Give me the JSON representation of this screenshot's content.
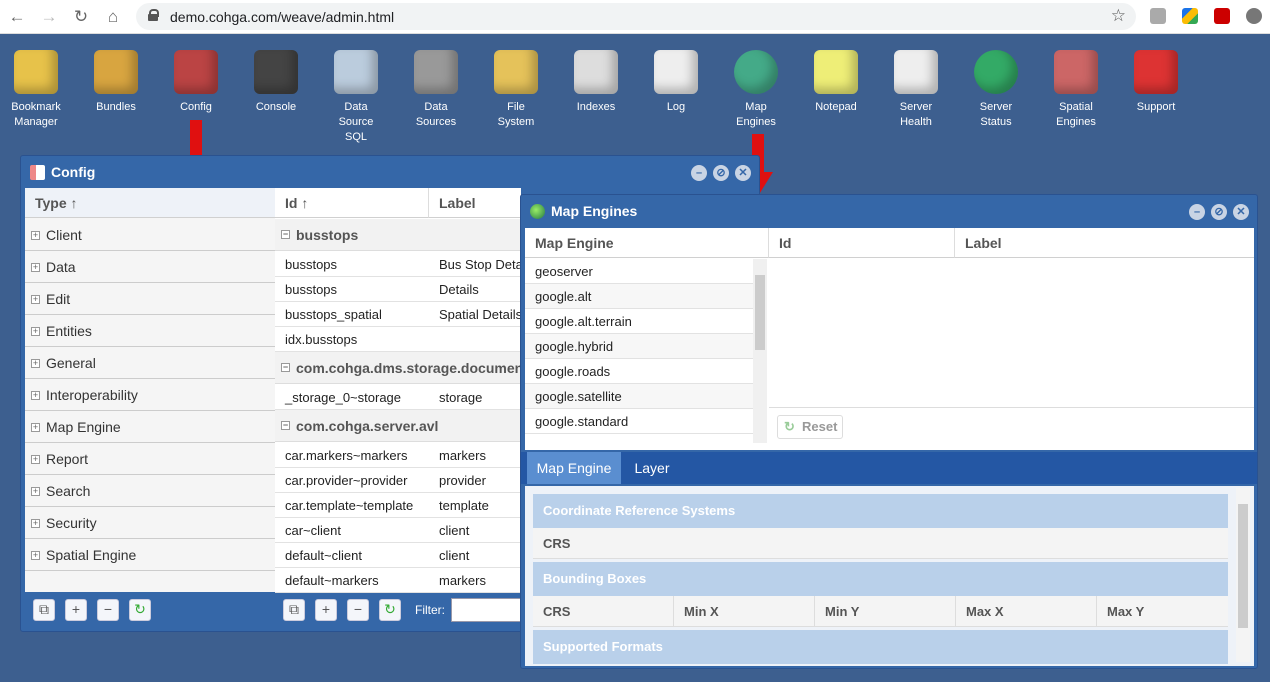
{
  "browser": {
    "url": "demo.cohga.com/weave/admin.html"
  },
  "desktop_icons": [
    {
      "label": "Bookmark\nManager",
      "icon": "bookmark-manager-icon"
    },
    {
      "label": "Bundles",
      "icon": "bundles-icon"
    },
    {
      "label": "Config",
      "icon": "config-icon"
    },
    {
      "label": "Console",
      "icon": "console-icon"
    },
    {
      "label": "Data\nSource\nSQL",
      "icon": "data-source-sql-icon"
    },
    {
      "label": "Data\nSources",
      "icon": "data-sources-icon"
    },
    {
      "label": "File\nSystem",
      "icon": "file-system-icon"
    },
    {
      "label": "Indexes",
      "icon": "indexes-icon"
    },
    {
      "label": "Log",
      "icon": "log-icon"
    },
    {
      "label": "Map\nEngines",
      "icon": "map-engines-icon"
    },
    {
      "label": "Notepad",
      "icon": "notepad-icon"
    },
    {
      "label": "Server\nHealth",
      "icon": "server-health-icon"
    },
    {
      "label": "Server\nStatus",
      "icon": "server-status-icon"
    },
    {
      "label": "Spatial\nEngines",
      "icon": "spatial-engines-icon"
    },
    {
      "label": "Support",
      "icon": "support-icon"
    }
  ],
  "config": {
    "title": "Config",
    "type_header": "Type ↑",
    "id_header": "Id ↑",
    "label_header": "Label",
    "types": [
      "Client",
      "Data",
      "Edit",
      "Entities",
      "General",
      "Interoperability",
      "Map Engine",
      "Report",
      "Search",
      "Security",
      "Spatial Engine"
    ],
    "groups": [
      "busstops",
      "com.cohga.dms.storage.document.c",
      "com.cohga.server.avl"
    ],
    "rows": [
      {
        "id": "busstops",
        "label": "Bus Stop Deta"
      },
      {
        "id": "busstops",
        "label": "Details"
      },
      {
        "id": "busstops_spatial",
        "label": "Spatial Details"
      },
      {
        "id": "idx.busstops",
        "label": ""
      },
      {
        "id": "_storage_0~storage",
        "label": "storage"
      },
      {
        "id": "car.markers~markers",
        "label": "markers"
      },
      {
        "id": "car.provider~provider",
        "label": "provider"
      },
      {
        "id": "car.template~template",
        "label": "template"
      },
      {
        "id": "car~client",
        "label": "client"
      },
      {
        "id": "default~client",
        "label": "client"
      },
      {
        "id": "default~markers",
        "label": "markers"
      }
    ],
    "filter_label": "Filter:"
  },
  "map_engines": {
    "title": "Map Engines",
    "headers": [
      "Map Engine",
      "Id",
      "Label"
    ],
    "engines": [
      "geoserver",
      "google.alt",
      "google.alt.terrain",
      "google.hybrid",
      "google.roads",
      "google.satellite",
      "google.standard"
    ],
    "reset_label": "Reset",
    "tabs": [
      "Map Engine",
      "Layer"
    ],
    "sections": {
      "crs_title": "Coordinate Reference Systems",
      "crs_col": "CRS",
      "bbox_title": "Bounding Boxes",
      "bbox_cols": [
        "CRS",
        "Min X",
        "Min Y",
        "Max X",
        "Max Y"
      ],
      "formats_title": "Supported Formats"
    }
  },
  "colors": {
    "desktop": "#3d5f8f",
    "window": "#3567a8",
    "arrow": "#e01010"
  }
}
